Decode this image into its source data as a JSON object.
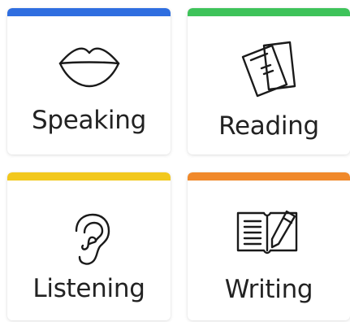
{
  "skills": [
    {
      "label": "Speaking",
      "icon": "lips-icon",
      "accent": "#2f6ee0"
    },
    {
      "label": "Reading",
      "icon": "book-icon",
      "accent": "#3ec35a"
    },
    {
      "label": "Listening",
      "icon": "ear-icon",
      "accent": "#f2c81d"
    },
    {
      "label": "Writing",
      "icon": "notebook-pen-icon",
      "accent": "#f0892a"
    }
  ]
}
